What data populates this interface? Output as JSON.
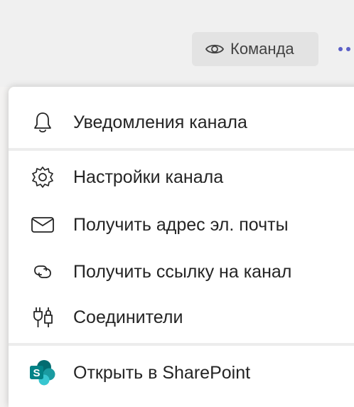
{
  "header": {
    "team_label": "Команда",
    "team_icon": "eye-icon",
    "more_icon": "more-dots-icon"
  },
  "menu": {
    "items": [
      {
        "label": "Уведомления канала",
        "icon": "bell-icon"
      },
      {
        "label": "Настройки канала",
        "icon": "gear-icon"
      },
      {
        "label": "Получить адрес эл. почты",
        "icon": "envelope-icon"
      },
      {
        "label": "Получить ссылку на канал",
        "icon": "link-icon"
      },
      {
        "label": "Соединители",
        "icon": "connectors-icon"
      },
      {
        "label": "Открыть в SharePoint",
        "icon": "sharepoint-icon"
      }
    ]
  },
  "colors": {
    "accent": "#5b5fc7",
    "sharepoint_dark": "#036c70",
    "sharepoint_mid": "#1a9ba1",
    "sharepoint_light": "#37c6d0"
  }
}
